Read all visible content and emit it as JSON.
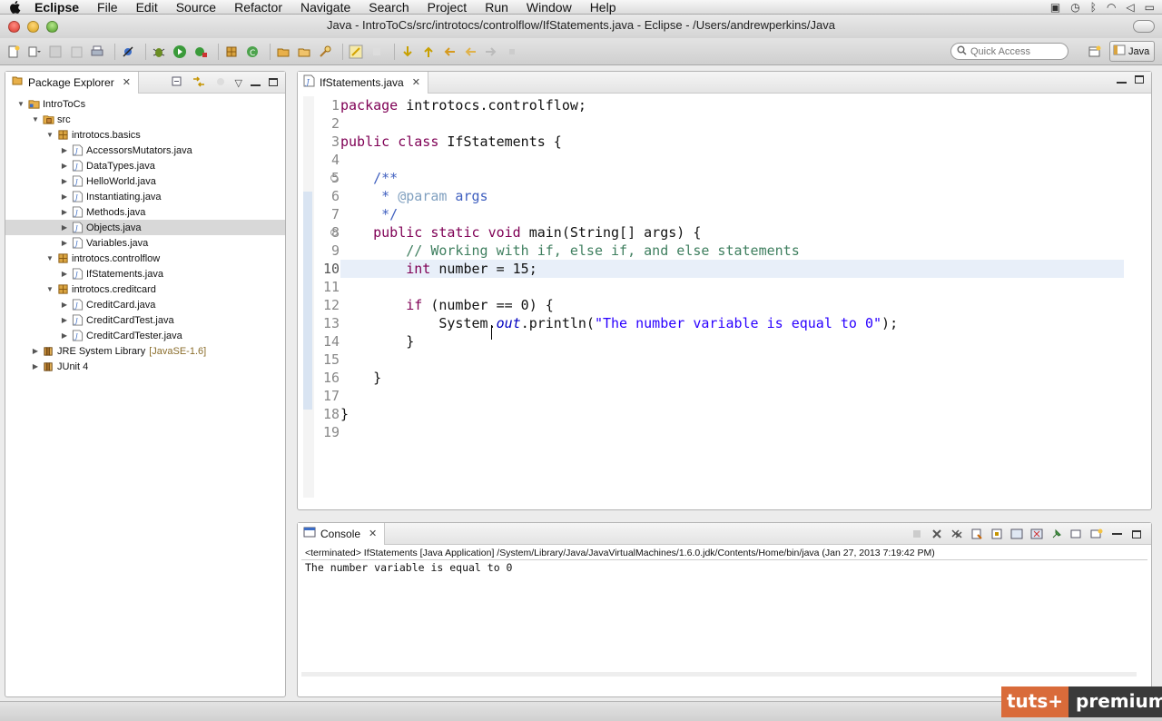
{
  "menubar": {
    "items": [
      "Eclipse",
      "File",
      "Edit",
      "Source",
      "Refactor",
      "Navigate",
      "Search",
      "Project",
      "Run",
      "Window",
      "Help"
    ]
  },
  "window": {
    "title": "Java - IntroToCs/src/introtocs/controlflow/IfStatements.java - Eclipse - /Users/andrewperkins/Java"
  },
  "toolbar": {
    "quick_access_placeholder": "Quick Access",
    "perspective_label": "Java"
  },
  "package_explorer": {
    "title": "Package Explorer",
    "tree": [
      {
        "label": "IntroToCs",
        "level": 0,
        "expanded": true,
        "icon": "project-icon"
      },
      {
        "label": "src",
        "level": 1,
        "expanded": true,
        "icon": "source-folder-icon"
      },
      {
        "label": "introtocs.basics",
        "level": 2,
        "expanded": true,
        "icon": "package-icon"
      },
      {
        "label": "AccessorsMutators.java",
        "level": 3,
        "expanded": false,
        "icon": "java-file-icon"
      },
      {
        "label": "DataTypes.java",
        "level": 3,
        "expanded": false,
        "icon": "java-file-icon"
      },
      {
        "label": "HelloWorld.java",
        "level": 3,
        "expanded": false,
        "icon": "java-file-icon"
      },
      {
        "label": "Instantiating.java",
        "level": 3,
        "expanded": false,
        "icon": "java-file-icon"
      },
      {
        "label": "Methods.java",
        "level": 3,
        "expanded": false,
        "icon": "java-file-icon"
      },
      {
        "label": "Objects.java",
        "level": 3,
        "expanded": false,
        "icon": "java-file-icon",
        "selected": true
      },
      {
        "label": "Variables.java",
        "level": 3,
        "expanded": false,
        "icon": "java-file-icon"
      },
      {
        "label": "introtocs.controlflow",
        "level": 2,
        "expanded": true,
        "icon": "package-icon"
      },
      {
        "label": "IfStatements.java",
        "level": 3,
        "expanded": false,
        "icon": "java-file-icon"
      },
      {
        "label": "introtocs.creditcard",
        "level": 2,
        "expanded": true,
        "icon": "package-icon"
      },
      {
        "label": "CreditCard.java",
        "level": 3,
        "expanded": false,
        "icon": "java-file-icon"
      },
      {
        "label": "CreditCardTest.java",
        "level": 3,
        "expanded": false,
        "icon": "java-file-icon"
      },
      {
        "label": "CreditCardTester.java",
        "level": 3,
        "expanded": false,
        "icon": "java-file-icon"
      },
      {
        "label": "JRE System Library",
        "decoration": "[JavaSE-1.6]",
        "level": 1,
        "expanded": false,
        "icon": "library-icon"
      },
      {
        "label": "JUnit 4",
        "level": 1,
        "expanded": false,
        "icon": "library-icon"
      }
    ]
  },
  "editor": {
    "tab_title": "IfStatements.java",
    "current_line": 10,
    "lines": [
      [
        {
          "t": "package",
          "c": "kw"
        },
        {
          "t": " introtocs.controlflow;",
          "c": ""
        }
      ],
      [],
      [
        {
          "t": "public",
          "c": "kw"
        },
        {
          "t": " ",
          "c": ""
        },
        {
          "t": "class",
          "c": "kw"
        },
        {
          "t": " IfStatements {",
          "c": ""
        }
      ],
      [],
      [
        {
          "t": "    /**",
          "c": "jd"
        }
      ],
      [
        {
          "t": "     * ",
          "c": "jd"
        },
        {
          "t": "@param",
          "c": "jdtag"
        },
        {
          "t": " args",
          "c": "jd"
        }
      ],
      [
        {
          "t": "     */",
          "c": "jd"
        }
      ],
      [
        {
          "t": "    ",
          "c": ""
        },
        {
          "t": "public",
          "c": "kw"
        },
        {
          "t": " ",
          "c": ""
        },
        {
          "t": "static",
          "c": "kw"
        },
        {
          "t": " ",
          "c": ""
        },
        {
          "t": "void",
          "c": "kw"
        },
        {
          "t": " main(String[] args) {",
          "c": ""
        }
      ],
      [
        {
          "t": "        // Working with if, else if, and else statements",
          "c": "cmt"
        }
      ],
      [
        {
          "t": "        ",
          "c": ""
        },
        {
          "t": "int",
          "c": "kw"
        },
        {
          "t": " number = 15;",
          "c": ""
        }
      ],
      [],
      [
        {
          "t": "        ",
          "c": ""
        },
        {
          "t": "if",
          "c": "kw"
        },
        {
          "t": " (number == 0) {",
          "c": ""
        }
      ],
      [
        {
          "t": "            System.",
          "c": ""
        },
        {
          "t": "out",
          "c": "fld"
        },
        {
          "t": ".println(",
          "c": ""
        },
        {
          "t": "\"The number variable is equal to 0\"",
          "c": "str"
        },
        {
          "t": ");",
          "c": ""
        }
      ],
      [
        {
          "t": "        }",
          "c": ""
        }
      ],
      [],
      [
        {
          "t": "    }",
          "c": ""
        }
      ],
      [],
      [
        {
          "t": "}",
          "c": ""
        }
      ],
      []
    ]
  },
  "console": {
    "title": "Console",
    "info": "<terminated> IfStatements [Java Application] /System/Library/Java/JavaVirtualMachines/1.6.0.jdk/Contents/Home/bin/java (Jan 27, 2013 7:19:42 PM)",
    "output": "The number variable is equal to 0"
  },
  "watermark": {
    "part1": "tuts+",
    "part2": "premium"
  },
  "colors": {
    "keyword": "#7f0055",
    "comment": "#3f7f5f",
    "javadoc": "#3f5fbf",
    "string": "#2a00ff",
    "current_line": "#e8eff9",
    "selection": "#d8d8d8"
  }
}
